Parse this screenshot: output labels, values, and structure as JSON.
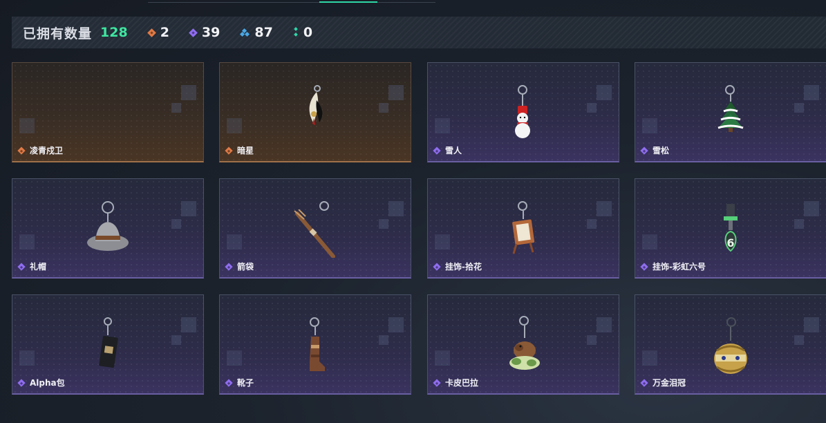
{
  "summary": {
    "label": "已拥有数量",
    "total": "128",
    "stats": [
      {
        "icon": "orange-diamond-icon",
        "color": "#e07a45",
        "count": "2"
      },
      {
        "icon": "purple-diamond-icon",
        "color": "#8f6df0",
        "count": "39"
      },
      {
        "icon": "blue-triangle-icon",
        "color": "#4aa7e6",
        "count": "87"
      },
      {
        "icon": "green-dots-icon",
        "color": "#2fd8a8",
        "count": "0"
      }
    ]
  },
  "items": [
    {
      "name": "凌青戍卫",
      "rarity": "orange",
      "icon": "none"
    },
    {
      "name": "暗星",
      "rarity": "orange",
      "icon": "feather-charm-icon"
    },
    {
      "name": "雪人",
      "rarity": "purple",
      "icon": "snowman-charm-icon"
    },
    {
      "name": "雪松",
      "rarity": "purple",
      "icon": "pine-tree-charm-icon"
    },
    {
      "name": "礼帽",
      "rarity": "purple",
      "icon": "hat-charm-icon"
    },
    {
      "name": "箭袋",
      "rarity": "purple",
      "icon": "quiver-charm-icon"
    },
    {
      "name": "挂饰-拾花",
      "rarity": "purple",
      "icon": "picture-frame-charm-icon"
    },
    {
      "name": "挂饰-彩虹六号",
      "rarity": "purple",
      "icon": "rainbow-six-charm-icon"
    },
    {
      "name": "Alpha包",
      "rarity": "purple",
      "icon": "bag-charm-icon"
    },
    {
      "name": "靴子",
      "rarity": "purple",
      "icon": "boot-charm-icon"
    },
    {
      "name": "卡皮巴拉",
      "rarity": "purple",
      "icon": "capybara-charm-icon"
    },
    {
      "name": "万金泪冠",
      "rarity": "purple",
      "icon": "golden-crown-charm-icon"
    }
  ]
}
